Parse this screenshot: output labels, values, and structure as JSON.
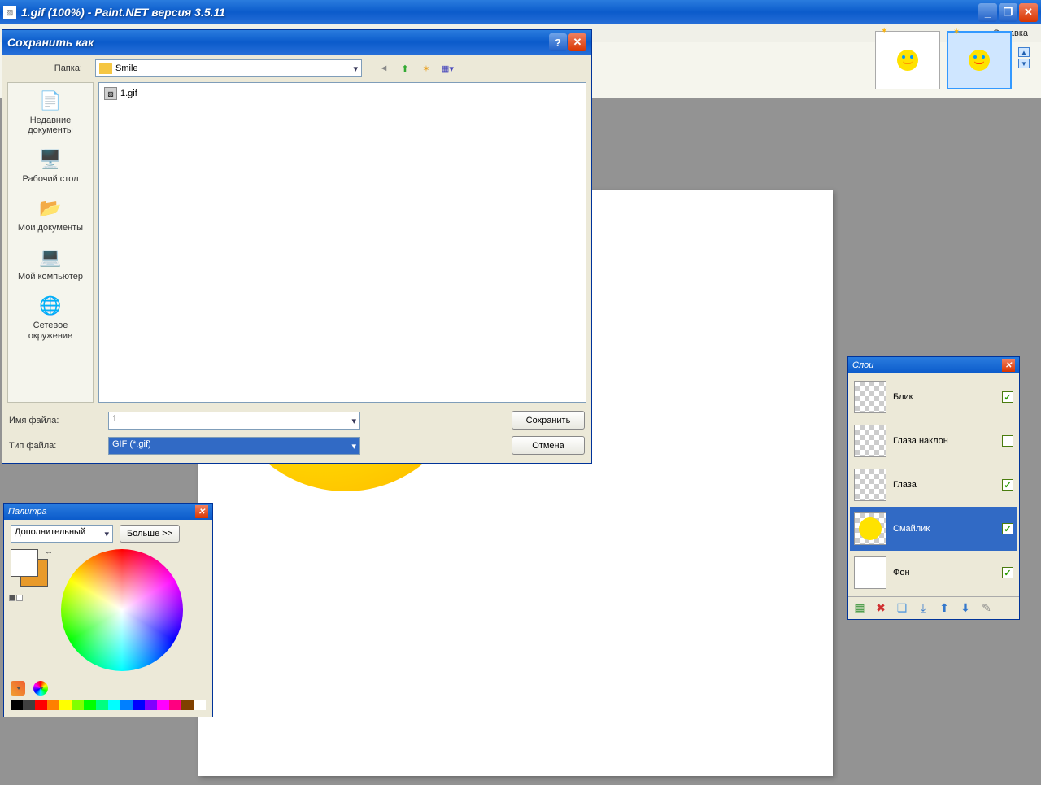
{
  "window": {
    "title": "1.gif (100%) - Paint.NET версия 3.5.11"
  },
  "menubar": {
    "help": "Справка"
  },
  "saveDialog": {
    "title": "Сохранить как",
    "folderLabel": "Папка:",
    "folderValue": "Smile",
    "places": {
      "recent": "Недавние документы",
      "desktop": "Рабочий стол",
      "mydocs": "Мои документы",
      "mycomp": "Мой компьютер",
      "network": "Сетевое окружение"
    },
    "fileList": [
      "1.gif"
    ],
    "filenameLabel": "Имя файла:",
    "filenameValue": "1",
    "filetypeLabel": "Тип файла:",
    "filetypeValue": "GIF (*.gif)",
    "saveBtn": "Сохранить",
    "cancelBtn": "Отмена"
  },
  "layers": {
    "title": "Слои",
    "items": [
      {
        "name": "Блик",
        "checked": true,
        "selected": false,
        "thumb": "checker"
      },
      {
        "name": "Глаза наклон",
        "checked": false,
        "selected": false,
        "thumb": "checker"
      },
      {
        "name": "Глаза",
        "checked": true,
        "selected": false,
        "thumb": "checker"
      },
      {
        "name": "Смайлик",
        "checked": true,
        "selected": true,
        "thumb": "yellow"
      },
      {
        "name": "Фон",
        "checked": true,
        "selected": false,
        "thumb": "white"
      }
    ]
  },
  "palette": {
    "title": "Палитра",
    "mode": "Дополнительный",
    "moreBtn": "Больше >>",
    "strip": [
      "#000000",
      "#404040",
      "#ff0000",
      "#ff8000",
      "#ffff00",
      "#80ff00",
      "#00ff00",
      "#00ff80",
      "#00ffff",
      "#0080ff",
      "#0000ff",
      "#8000ff",
      "#ff00ff",
      "#ff0080",
      "#804000",
      "#ffffff"
    ]
  }
}
